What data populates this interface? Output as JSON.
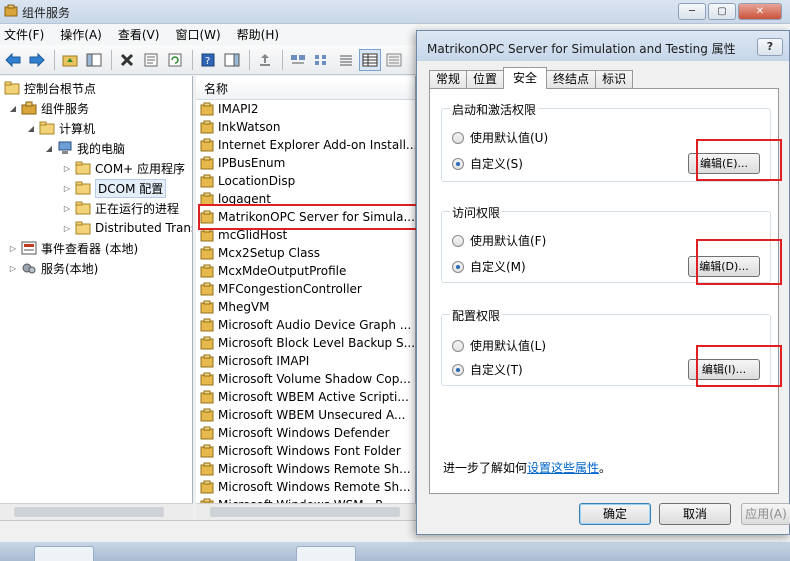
{
  "main_window": {
    "title": "组件服务",
    "menu": [
      "文件(F)",
      "操作(A)",
      "查看(V)",
      "窗口(W)",
      "帮助(H)"
    ],
    "win_buttons": [
      "─",
      "▢",
      "✕"
    ]
  },
  "tree": {
    "items": [
      {
        "label": "控制台根节点",
        "level": 0,
        "icon": "folder-icon"
      },
      {
        "label": "组件服务",
        "level": 1,
        "icon": "component-services-icon"
      },
      {
        "label": "计算机",
        "level": 2,
        "icon": "folder-icon"
      },
      {
        "label": "我的电脑",
        "level": 3,
        "icon": "computer-icon"
      },
      {
        "label": "COM+ 应用程序",
        "level": 4,
        "icon": "folder-icon"
      },
      {
        "label": "DCOM 配置",
        "level": 4,
        "icon": "folder-icon",
        "selected": true
      },
      {
        "label": "正在运行的进程",
        "level": 4,
        "icon": "folder-icon"
      },
      {
        "label": "Distributed Transaction Coordinator",
        "level": 4,
        "icon": "folder-icon"
      },
      {
        "label": "事件查看器 (本地)",
        "level": 0,
        "icon": "event-viewer-icon"
      },
      {
        "label": "服务(本地)",
        "level": 0,
        "icon": "services-icon"
      }
    ]
  },
  "list": {
    "header": "名称",
    "items": [
      "IMAPI2",
      "InkWatson",
      "Internet Explorer Add-on Install...",
      "IPBusEnum",
      "LocationDisp",
      "logagent",
      "MatrikonOPC Server for Simula...",
      "mcGlidHost",
      "Mcx2Setup Class",
      "McxMdeOutputProfile",
      "MFCongestionController",
      "MhegVM",
      "Microsoft Audio Device Graph ...",
      "Microsoft Block Level Backup S...",
      "Microsoft IMAPI",
      "Microsoft Volume Shadow Cop...",
      "Microsoft WBEM Active Scripti...",
      "Microsoft WBEM Unsecured A...",
      "Microsoft Windows Defender",
      "Microsoft Windows Font Folder",
      "Microsoft Windows Remote Sh...",
      "Microsoft Windows Remote Sh...",
      "Microsoft Windows WSM...P..."
    ]
  },
  "dialog": {
    "title": "MatrikonOPC Server for Simulation and Testing 属性",
    "help": "?",
    "tabs": [
      "常规",
      "位置",
      "安全",
      "终结点",
      "标识"
    ],
    "active_tab": "安全",
    "groups": [
      {
        "title": "启动和激活权限",
        "default_label": "使用默认值(U)",
        "custom_label": "自定义(S)",
        "edit_label": "编辑(E)..."
      },
      {
        "title": "访问权限",
        "default_label": "使用默认值(F)",
        "custom_label": "自定义(M)",
        "edit_label": "编辑(D)..."
      },
      {
        "title": "配置权限",
        "default_label": "使用默认值(L)",
        "custom_label": "自定义(T)",
        "edit_label": "编辑(I)..."
      }
    ],
    "learn_prefix": "进一步了解如何",
    "learn_link": "设置这些属性",
    "learn_suffix": "。",
    "buttons": {
      "ok": "确定",
      "cancel": "取消",
      "apply": "应用(A)"
    }
  }
}
